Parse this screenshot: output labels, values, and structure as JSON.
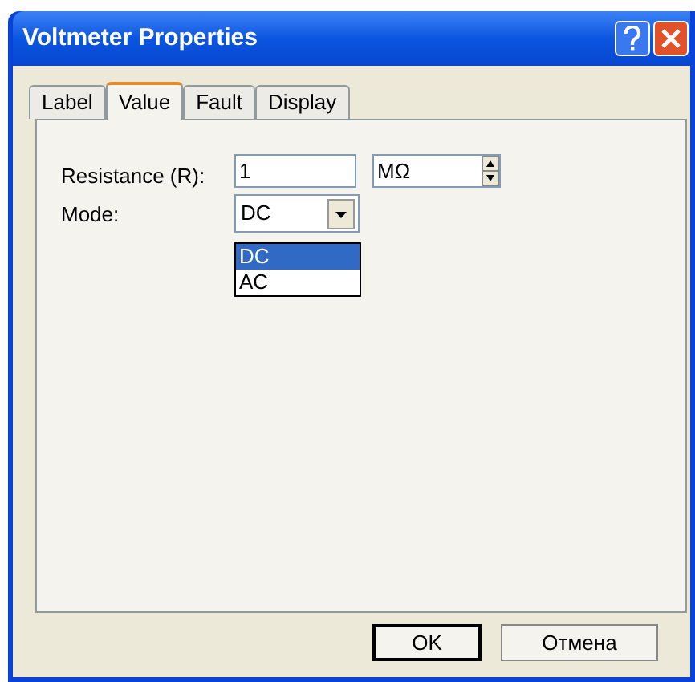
{
  "window": {
    "title": "Voltmeter Properties"
  },
  "tabs": [
    {
      "label": "Label",
      "selected": false
    },
    {
      "label": "Value",
      "selected": true
    },
    {
      "label": "Fault",
      "selected": false
    },
    {
      "label": "Display",
      "selected": false
    }
  ],
  "resistance": {
    "label": "Resistance (R):",
    "value": "1",
    "unit": "MΩ"
  },
  "mode": {
    "label": "Mode:",
    "value": "DC",
    "expanded": true,
    "options": [
      {
        "label": "DC",
        "selected": true
      },
      {
        "label": "AC",
        "selected": false
      }
    ]
  },
  "buttons": [
    "OK",
    "Отмена"
  ]
}
